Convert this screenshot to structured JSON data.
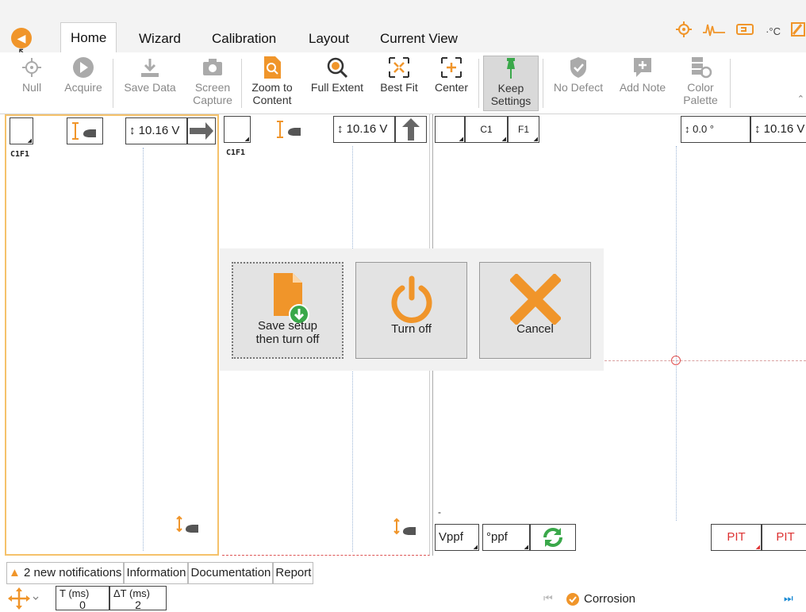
{
  "ribbon": {
    "tabs": [
      {
        "label": "Home",
        "active": true
      },
      {
        "label": "Wizard"
      },
      {
        "label": "Calibration"
      },
      {
        "label": "Layout"
      },
      {
        "label": "Current View"
      }
    ],
    "status_icons": [
      "crosshair-icon",
      "signal-icon",
      "probe-icon",
      "temperature-icon",
      "edit-icon"
    ],
    "temp_label": "·°C"
  },
  "toolbar": {
    "null_label": "Null",
    "acquire_label": "Acquire",
    "save_data_label": "Save Data",
    "screen_capture_label": [
      "Screen",
      "Capture"
    ],
    "zoom_content_label": [
      "Zoom to",
      "Content"
    ],
    "full_extent_label": "Full Extent",
    "best_fit_label": "Best Fit",
    "center_label": "Center",
    "keep_settings_label": [
      "Keep",
      "Settings"
    ],
    "no_defect_label": "No Defect",
    "add_note_label": "Add Note",
    "color_palette_label": [
      "Color",
      "Palette"
    ]
  },
  "panes": {
    "p1": {
      "voltage": "↕ 10.16 V",
      "label": "C1F1"
    },
    "p2": {
      "voltage": "↕ 10.16 V",
      "label": "C1F1"
    },
    "p3": {
      "c1": "C1",
      "f1": "F1",
      "angle": "↕   0.0 °",
      "voltage": "↕ 10.16 V",
      "vppf": "Vppf",
      "deg_ppf": "°ppf",
      "pit1": "PIT",
      "pit2": "PIT",
      "minus": "-"
    }
  },
  "dialog": {
    "save_label": [
      "Save setup",
      "then turn off"
    ],
    "turn_off_label": "Turn off",
    "cancel_label": "Cancel"
  },
  "bottom_tabs": {
    "notifications": "2 new notifications",
    "information": "Information",
    "documentation": "Documentation",
    "report": "Report"
  },
  "status_bar": {
    "t_label": "T (ms)",
    "t_value": "0",
    "dt_label": "ΔT (ms)",
    "dt_value": "2",
    "corrosion_label": "Corrosion"
  },
  "colors": {
    "accent": "#f0952a",
    "green": "#3aa84a",
    "pit": "#d33333"
  }
}
